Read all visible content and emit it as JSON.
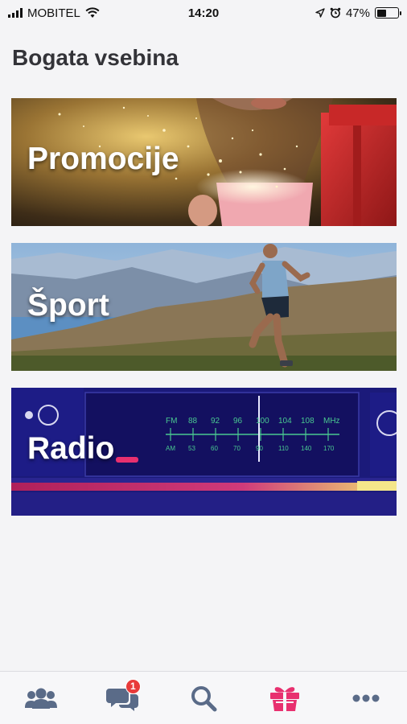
{
  "status_bar": {
    "carrier": "MOBITEL",
    "time": "14:20",
    "battery": "47%",
    "battery_level": 0.47,
    "icons": [
      "signal-icon",
      "wifi-icon",
      "location-icon",
      "alarm-icon",
      "battery-icon"
    ]
  },
  "header": {
    "title": "Bogata vsebina"
  },
  "cards": [
    {
      "label": "Promocije"
    },
    {
      "label": "Šport"
    },
    {
      "label": "Radio"
    }
  ],
  "tab_bar": {
    "tabs": [
      {
        "icon": "people-icon",
        "active": false
      },
      {
        "icon": "chat-icon",
        "active": false,
        "badge": "1"
      },
      {
        "icon": "search-icon",
        "active": false
      },
      {
        "icon": "gift-icon",
        "active": true
      },
      {
        "icon": "more-icon",
        "active": false
      }
    ],
    "colors": {
      "inactive": "#5a6b88",
      "active": "#e8306f"
    }
  },
  "radio_dial": {
    "fm_labels": [
      "FM",
      "88",
      "92",
      "96",
      "100",
      "104",
      "108",
      "MHz"
    ],
    "am_labels": [
      "AM",
      "53",
      "60",
      "70",
      "90",
      "110",
      "140",
      "170"
    ]
  }
}
